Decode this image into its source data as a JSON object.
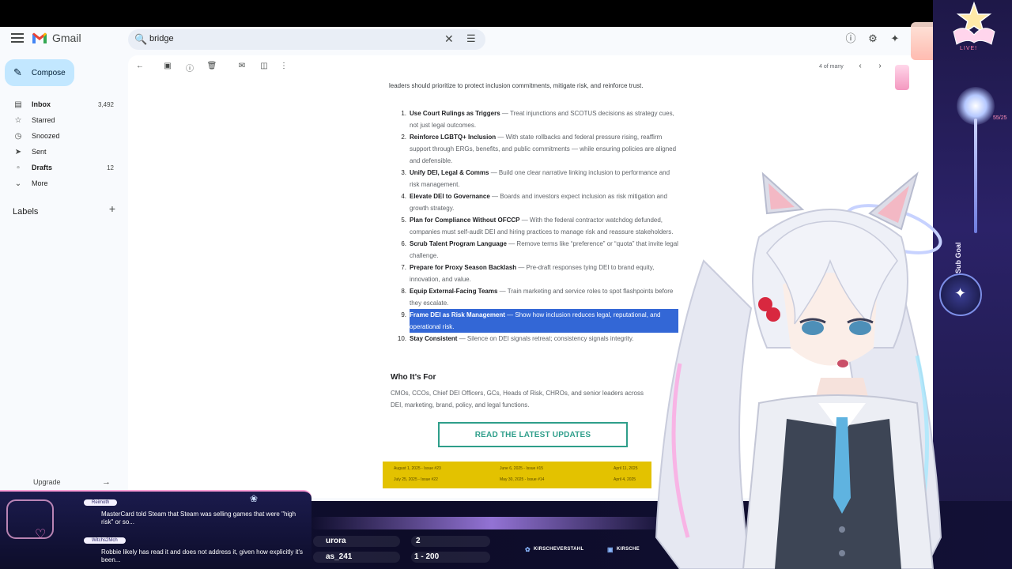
{
  "gmail": {
    "brand": "Gmail",
    "search_value": "bridge",
    "compose_label": "Compose",
    "nav": [
      {
        "label": "Inbox",
        "count": "3,492",
        "bold": true
      },
      {
        "label": "Starred",
        "count": ""
      },
      {
        "label": "Snoozed",
        "count": ""
      },
      {
        "label": "Sent",
        "count": ""
      },
      {
        "label": "Drafts",
        "count": "12",
        "bold": true
      },
      {
        "label": "More",
        "count": ""
      }
    ],
    "labels_heading": "Labels",
    "upgrade_label": "Upgrade",
    "pager": "4 of many"
  },
  "email": {
    "intro": "leaders should prioritize to protect inclusion commitments, mitigate risk, and reinforce trust.",
    "items": [
      {
        "num": "1.",
        "title": "Use Court Rulings as Triggers",
        "text": " — Treat injunctions and SCOTUS decisions as strategy cues, not just legal outcomes."
      },
      {
        "num": "2.",
        "title": "Reinforce LGBTQ+ Inclusion",
        "text": " — With state rollbacks and federal pressure rising, reaffirm support through ERGs, benefits, and public commitments — while ensuring policies are aligned and defensible."
      },
      {
        "num": "3.",
        "title": "Unify DEI, Legal & Comms",
        "text": " — Build one clear narrative linking inclusion to performance and risk management."
      },
      {
        "num": "4.",
        "title": "Elevate DEI to Governance",
        "text": " — Boards and investors expect inclusion as risk mitigation and growth strategy."
      },
      {
        "num": "5.",
        "title": "Plan for Compliance Without OFCCP",
        "text": " — With the federal contractor watchdog defunded, companies must self-audit DEI and hiring practices to manage risk and reassure stakeholders."
      },
      {
        "num": "6.",
        "title": "Scrub Talent Program Language",
        "text": " — Remove terms like “preference” or “quota” that invite legal challenge."
      },
      {
        "num": "7.",
        "title": "Prepare for Proxy Season Backlash",
        "text": " — Pre-draft responses tying DEI to brand equity, innovation, and value."
      },
      {
        "num": "8.",
        "title": "Equip External-Facing Teams",
        "text": " — Train marketing and service roles to spot flashpoints before they escalate."
      },
      {
        "num": "9.",
        "title": "Frame DEI as Risk Management",
        "text": " — Show how inclusion reduces legal, reputational, and operational risk.",
        "selected": true
      },
      {
        "num": "10.",
        "title": "Stay Consistent",
        "text": " — Silence on DEI signals retreat; consistency signals integrity."
      }
    ],
    "who_heading": "Who It’s For",
    "who_text": "CMOs, CCOs, Chief DEI Officers, GCs, Heads of Risk, CHROs, and senior leaders across DEI, marketing, brand, policy, and legal functions.",
    "cta": "READ THE LATEST UPDATES",
    "issues": [
      "August 1, 2025 - Issue #23",
      "June 6, 2025 - Issue #15",
      "April 11, 2025",
      "July 25, 2025 - Issue #22",
      "May 30, 2025 - Issue #14",
      "April 4, 2025"
    ]
  },
  "overlay": {
    "live": "LIVE!",
    "goal_label": "Daily Sub Goal",
    "goal_count": "55/25",
    "chat": [
      {
        "user": "Reimoth",
        "text": "MasterCard told Steam that Steam was selling games that were \"high risk\" or so..."
      },
      {
        "user": "Witchs2Mch",
        "text": "Robbie likely has read it and does not address it, given how explicitly it's been..."
      }
    ],
    "stat_names": [
      "urora",
      "as_241"
    ],
    "stat_values": [
      "2",
      "1 - 200"
    ],
    "socials": [
      "KIRSCHEVERSTAHL",
      "KIRSCHE"
    ]
  },
  "colors": {
    "selection": "#3367d6",
    "cta": "#2e9e8a",
    "compose_bg": "#c2e7ff",
    "issues_bg": "#e3c200"
  }
}
